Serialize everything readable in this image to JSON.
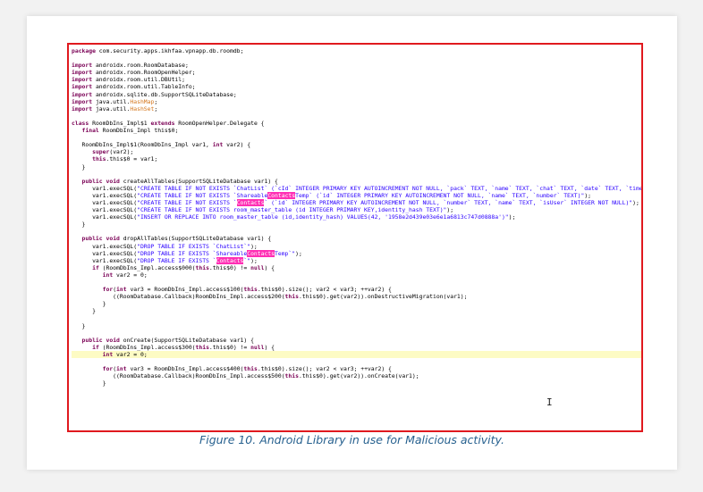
{
  "code_lines": [
    {
      "segs": [
        {
          "t": "package",
          "c": "kw"
        },
        {
          "t": " com.security.apps.ikhfaa.vpnapp.db.roomdb;"
        }
      ]
    },
    {
      "segs": [
        {
          "t": " "
        }
      ]
    },
    {
      "segs": [
        {
          "t": "import",
          "c": "kw"
        },
        {
          "t": " androidx.room.RoomDatabase;"
        }
      ]
    },
    {
      "segs": [
        {
          "t": "import",
          "c": "kw"
        },
        {
          "t": " androidx.room.RoomOpenHelper;"
        }
      ]
    },
    {
      "segs": [
        {
          "t": "import",
          "c": "kw"
        },
        {
          "t": " androidx.room.util.DBUtil;"
        }
      ]
    },
    {
      "segs": [
        {
          "t": "import",
          "c": "kw"
        },
        {
          "t": " androidx.room.util.TableInfo;"
        }
      ]
    },
    {
      "segs": [
        {
          "t": "import",
          "c": "kw"
        },
        {
          "t": " androidx.sqlite.db.SupportSQLiteDatabase;"
        }
      ]
    },
    {
      "segs": [
        {
          "t": "import",
          "c": "kw"
        },
        {
          "t": " java.util."
        },
        {
          "t": "HashMap",
          "c": "typ"
        },
        {
          "t": ";"
        }
      ]
    },
    {
      "segs": [
        {
          "t": "import",
          "c": "kw"
        },
        {
          "t": " java.util."
        },
        {
          "t": "HashSet",
          "c": "typ"
        },
        {
          "t": ";"
        }
      ]
    },
    {
      "segs": [
        {
          "t": " "
        }
      ]
    },
    {
      "segs": [
        {
          "t": "class",
          "c": "kw"
        },
        {
          "t": " RoomDbIns_Impl$1 "
        },
        {
          "t": "extends",
          "c": "kw"
        },
        {
          "t": " RoomOpenHelper.Delegate {"
        }
      ]
    },
    {
      "segs": [
        {
          "t": "   "
        },
        {
          "t": "final",
          "c": "kw"
        },
        {
          "t": " RoomDbIns_Impl this$0;"
        }
      ]
    },
    {
      "segs": [
        {
          "t": " "
        }
      ]
    },
    {
      "segs": [
        {
          "t": "   RoomDbIns_Impl$1(RoomDbIns_Impl var1, "
        },
        {
          "t": "int",
          "c": "kw"
        },
        {
          "t": " var2) {"
        }
      ]
    },
    {
      "segs": [
        {
          "t": "      "
        },
        {
          "t": "super",
          "c": "kw"
        },
        {
          "t": "(var2);"
        }
      ]
    },
    {
      "segs": [
        {
          "t": "      "
        },
        {
          "t": "this",
          "c": "kw"
        },
        {
          "t": ".this$0 = var1;"
        }
      ]
    },
    {
      "segs": [
        {
          "t": "   }"
        }
      ]
    },
    {
      "segs": [
        {
          "t": " "
        }
      ]
    },
    {
      "segs": [
        {
          "t": "   "
        },
        {
          "t": "public",
          "c": "kw"
        },
        {
          "t": " "
        },
        {
          "t": "void",
          "c": "kw"
        },
        {
          "t": " createAllTables(SupportSQLiteDatabase var1) {"
        }
      ]
    },
    {
      "segs": [
        {
          "t": "      var1.execSQL("
        },
        {
          "t": "\"CREATE TABLE IF NOT EXISTS `ChatList` (`cId` INTEGER PRIMARY KEY AUTOINCREMENT NOT NULL, `pack` TEXT, `name` TEXT, `chat` TEXT, `date` TEXT, `time` TEXT",
          "c": "str"
        }
      ]
    },
    {
      "segs": [
        {
          "t": "      var1.execSQL("
        },
        {
          "t": "\"CREATE TABLE IF NOT EXISTS `Shareable",
          "c": "str"
        },
        {
          "t": "Contacts",
          "c": "pink"
        },
        {
          "t": "Temp` (`id` INTEGER PRIMARY KEY AUTOINCREMENT NOT NULL, `name` TEXT, `number` TEXT)\"",
          "c": "str"
        },
        {
          "t": ");"
        }
      ]
    },
    {
      "segs": [
        {
          "t": "      var1.execSQL("
        },
        {
          "t": "\"CREATE TABLE IF NOT EXISTS `",
          "c": "str"
        },
        {
          "t": "Contacts",
          "c": "pink"
        },
        {
          "t": "` (`id` INTEGER PRIMARY KEY AUTOINCREMENT NOT NULL, `number` TEXT, `name` TEXT, `isUser` INTEGER NOT NULL)\"",
          "c": "str"
        },
        {
          "t": ");"
        }
      ]
    },
    {
      "segs": [
        {
          "t": "      var1.execSQL("
        },
        {
          "t": "\"CREATE TABLE IF NOT EXISTS room_master_table (id INTEGER PRIMARY KEY,identity_hash TEXT)\"",
          "c": "str"
        },
        {
          "t": ");"
        }
      ]
    },
    {
      "segs": [
        {
          "t": "      var1.execSQL("
        },
        {
          "t": "\"INSERT OR REPLACE INTO room_master_table (id,identity_hash) VALUES(42, '1958e2d439e03e6e1a6813c747d0888a')\"",
          "c": "str"
        },
        {
          "t": ");"
        }
      ]
    },
    {
      "segs": [
        {
          "t": "   }"
        }
      ]
    },
    {
      "segs": [
        {
          "t": " "
        }
      ]
    },
    {
      "segs": [
        {
          "t": "   "
        },
        {
          "t": "public",
          "c": "kw"
        },
        {
          "t": " "
        },
        {
          "t": "void",
          "c": "kw"
        },
        {
          "t": " dropAllTables(SupportSQLiteDatabase var1) {"
        }
      ]
    },
    {
      "segs": [
        {
          "t": "      var1.execSQL("
        },
        {
          "t": "\"DROP TABLE IF EXISTS `ChatList`\"",
          "c": "str"
        },
        {
          "t": ");"
        }
      ]
    },
    {
      "segs": [
        {
          "t": "      var1.execSQL("
        },
        {
          "t": "\"DROP TABLE IF EXISTS `Shareable",
          "c": "str"
        },
        {
          "t": "Contacts",
          "c": "pink"
        },
        {
          "t": "Temp`\"",
          "c": "str"
        },
        {
          "t": ");"
        }
      ]
    },
    {
      "segs": [
        {
          "t": "      var1.execSQL("
        },
        {
          "t": "\"DROP TABLE IF EXISTS `",
          "c": "str"
        },
        {
          "t": "Contacts",
          "c": "pink"
        },
        {
          "t": "`\"",
          "c": "str"
        },
        {
          "t": ");"
        }
      ]
    },
    {
      "segs": [
        {
          "t": "      "
        },
        {
          "t": "if",
          "c": "kw"
        },
        {
          "t": " (RoomDbIns_Impl.access$000("
        },
        {
          "t": "this",
          "c": "kw"
        },
        {
          "t": ".this$0) != "
        },
        {
          "t": "null",
          "c": "kw"
        },
        {
          "t": ") {"
        }
      ]
    },
    {
      "segs": [
        {
          "t": "         "
        },
        {
          "t": "int",
          "c": "kw"
        },
        {
          "t": " var2 = 0;"
        }
      ]
    },
    {
      "segs": [
        {
          "t": " "
        }
      ]
    },
    {
      "segs": [
        {
          "t": "         "
        },
        {
          "t": "for",
          "c": "kw"
        },
        {
          "t": "("
        },
        {
          "t": "int",
          "c": "kw"
        },
        {
          "t": " var3 = RoomDbIns_Impl.access$100("
        },
        {
          "t": "this",
          "c": "kw"
        },
        {
          "t": ".this$0).size(); var2 < var3; ++var2) {"
        }
      ]
    },
    {
      "segs": [
        {
          "t": "            ((RoomDatabase.Callback)RoomDbIns_Impl.access$200("
        },
        {
          "t": "this",
          "c": "kw"
        },
        {
          "t": ".this$0).get(var2)).onDestructiveMigration(var1);"
        }
      ]
    },
    {
      "segs": [
        {
          "t": "         }"
        }
      ]
    },
    {
      "segs": [
        {
          "t": "      }"
        }
      ]
    },
    {
      "segs": [
        {
          "t": " "
        }
      ]
    },
    {
      "segs": [
        {
          "t": "   }"
        }
      ]
    },
    {
      "segs": [
        {
          "t": " "
        }
      ]
    },
    {
      "segs": [
        {
          "t": "   "
        },
        {
          "t": "public",
          "c": "kw"
        },
        {
          "t": " "
        },
        {
          "t": "void",
          "c": "kw"
        },
        {
          "t": " onCreate(SupportSQLiteDatabase var1) {"
        }
      ]
    },
    {
      "segs": [
        {
          "t": "      "
        },
        {
          "t": "if",
          "c": "kw"
        },
        {
          "t": " (RoomDbIns_Impl.access$300("
        },
        {
          "t": "this",
          "c": "kw"
        },
        {
          "t": ".this$0) != "
        },
        {
          "t": "null",
          "c": "kw"
        },
        {
          "t": ") {"
        }
      ]
    },
    {
      "segs": [
        {
          "t": "         "
        },
        {
          "t": "int",
          "c": "kw"
        },
        {
          "t": " var2 = 0;"
        }
      ],
      "highlight": true
    },
    {
      "segs": [
        {
          "t": " "
        }
      ]
    },
    {
      "segs": [
        {
          "t": "         "
        },
        {
          "t": "for",
          "c": "kw"
        },
        {
          "t": "("
        },
        {
          "t": "int",
          "c": "kw"
        },
        {
          "t": " var3 = RoomDbIns_Impl.access$400("
        },
        {
          "t": "this",
          "c": "kw"
        },
        {
          "t": ".this$0).size(); var2 < var3; ++var2) {"
        }
      ]
    },
    {
      "segs": [
        {
          "t": "            ((RoomDatabase.Callback)RoomDbIns_Impl.access$500("
        },
        {
          "t": "this",
          "c": "kw"
        },
        {
          "t": ".this$0).get(var2)).onCreate(var1);"
        }
      ]
    },
    {
      "segs": [
        {
          "t": "         }"
        }
      ]
    }
  ],
  "caption": "Figure 10. Android Library in use for Malicious activity.",
  "colors": {
    "frame_border": "#e0191e",
    "caption": "#27618f",
    "keyword": "#7a0055",
    "string": "#2a00ff",
    "highlight_pink": "#ff2fb4",
    "current_line": "#fdfbc4"
  }
}
